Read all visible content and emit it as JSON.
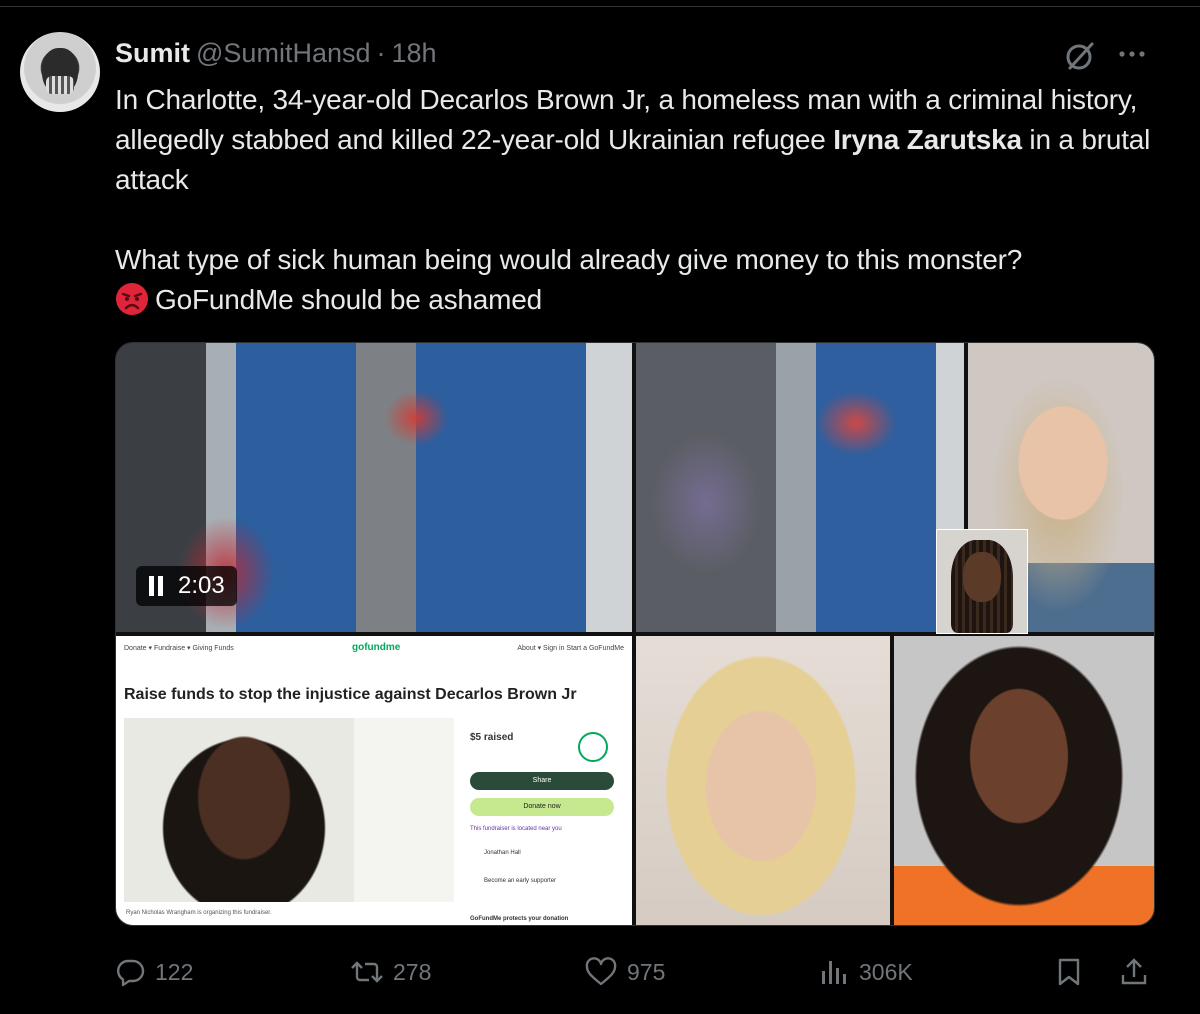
{
  "tweet": {
    "author_name": "Sumit",
    "handle": "@SumitHansd",
    "separator": "·",
    "time": "18h",
    "body_line1_part1": "In Charlotte, 34-year-old Decarlos Brown Jr, a homeless man with a criminal history, allegedly stabbed and killed 22-year-old Ukrainian refugee ",
    "body_line1_bold": "Iryna Zarutska",
    "body_line1_part2": " in a brutal attack",
    "body_line2": "What type of sick human being would already give money to this monster?",
    "body_line3": "GoFundMe should be ashamed",
    "emoji_icon": "angry-face-icon"
  },
  "media": {
    "video_timer": "2:03",
    "gofundme": {
      "nav_left": "Donate ▾   Fundraise ▾   Giving Funds",
      "logo": "gofundme",
      "nav_right": "About ▾   Sign in   Start a GoFundMe",
      "title": "Raise funds to stop the injustice against Decarlos Brown Jr",
      "raised": "$5 raised",
      "share": "Share",
      "donate": "Donate now",
      "location": "This fundraiser is located near you",
      "donor1": "Jonathan Hall",
      "donor2": "Become an early supporter",
      "organizer": "Ryan Nicholas Wrangham is organizing this fundraiser.",
      "protect": "GoFundMe protects your donation"
    }
  },
  "actions": {
    "replies": "122",
    "reposts": "278",
    "likes": "975",
    "views": "306K"
  },
  "colors": {
    "background": "#000000",
    "text": "#e7e9ea",
    "muted": "#71767b"
  }
}
